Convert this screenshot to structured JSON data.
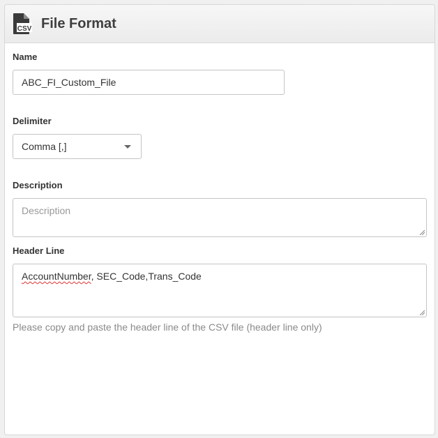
{
  "header": {
    "title": "File Format",
    "icon": "csv-file-icon",
    "icon_text": "CSV"
  },
  "form": {
    "name": {
      "label": "Name",
      "value": "ABC_FI_Custom_File"
    },
    "delimiter": {
      "label": "Delimiter",
      "selected": "Comma [,]"
    },
    "description": {
      "label": "Description",
      "placeholder": "Description",
      "value": ""
    },
    "header_line": {
      "label": "Header Line",
      "value_misspelled": "AccountNumber",
      "value_rest": ", SEC_Code,Trans_Code",
      "help": "Please copy and paste the header line of the CSV file (header line only)"
    }
  },
  "colors": {
    "header_bg": "#eeeeee",
    "title": "#3e3e3e",
    "border": "#c4c4c4",
    "help_text": "#8a8a8a",
    "spell_error": "#e03030"
  }
}
